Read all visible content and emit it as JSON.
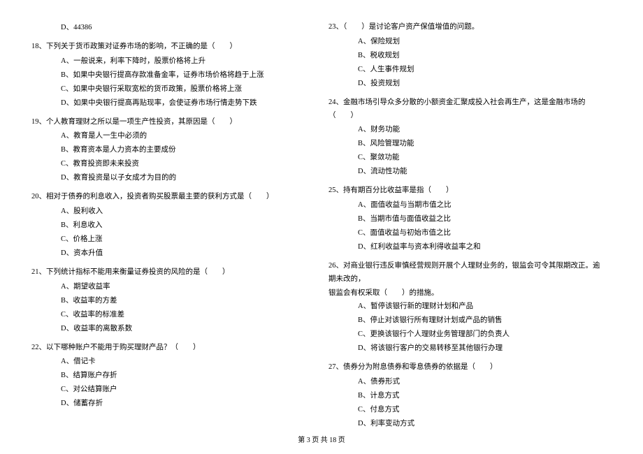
{
  "left": {
    "pre_option": "D、44386",
    "q18": {
      "stem": "18、下列关于货币政策对证券市场的影响，不正确的是（　　）",
      "A": "A、一般说来，利率下降时，股票价格将上升",
      "B": "B、如果中央银行提高存款准备金率，证券市场价格将趋于上涨",
      "C": "C、如果中央银行采取宽松的货币政策，股票价格将上涨",
      "D": "D、如果中央银行提高再贴现率，会使证券市场行情走势下跌"
    },
    "q19": {
      "stem": "19、个人教育理财之所以是一项生产性投资，其原因是（　　）",
      "A": "A、教育是人一生中必须的",
      "B": "B、教育资本是人力资本的主要成份",
      "C": "C、教育投资即未来投资",
      "D": "D、教育投资是以子女成才为目的的"
    },
    "q20": {
      "stem": "20、相对于债券的利息收入，投资者购买股票最主要的获利方式是（　　）",
      "A": "A、股利收入",
      "B": "B、利息收入",
      "C": "C、价格上涨",
      "D": "D、资本升值"
    },
    "q21": {
      "stem": "21、下列统计指标不能用来衡量证券投资的风险的是（　　）",
      "A": "A、期望收益率",
      "B": "B、收益率的方差",
      "C": "C、收益率的标准差",
      "D": "D、收益率的离散系数"
    },
    "q22": {
      "stem": "22、以下哪种账户不能用于购买理财产品？（　　）",
      "A": "A、借记卡",
      "B": "B、结算账户存折",
      "C": "C、对公结算账户",
      "D": "D、储蓄存折"
    }
  },
  "right": {
    "q23": {
      "stem": "23、（　　）是讨论客户资产保值增值的问题。",
      "A": "A、保险规划",
      "B": "B、税收规划",
      "C": "C、人生事件规划",
      "D": "D、投资规划"
    },
    "q24": {
      "stem": "24、金融市场引导众多分散的小额资金汇聚成投入社会再生产，这是金融市场的（　　）",
      "A": "A、财务功能",
      "B": "B、风险管理功能",
      "C": "C、聚敛功能",
      "D": "D、流动性功能"
    },
    "q25": {
      "stem": "25、持有期百分比收益率是指（　　）",
      "A": "A、面值收益与当期市值之比",
      "B": "B、当期市值与面值收益之比",
      "C": "C、面值收益与初始市值之比",
      "D": "D、红利收益率与资本利得收益率之和"
    },
    "q26": {
      "stem_line1": "26、对商业银行违反审慎经营规则开展个人理财业务的，银监会可令其限期改正。逾期未改的，",
      "stem_line2": "银监会有权采取（　　）的措施。",
      "A": "A、暂停该银行新的理财计划和产品",
      "B": "B、停止对该银行所有理财计划或产品的销售",
      "C": "C、更换该银行个人理财业务管理部门的负责人",
      "D": "D、将该银行客户的交易转移至其他银行办理"
    },
    "q27": {
      "stem": "27、债券分为附息债券和零息债券的依据是（　　）",
      "A": "A、债券形式",
      "B": "B、计息方式",
      "C": "C、付息方式",
      "D": "D、利率变动方式"
    }
  },
  "footer": "第 3 页 共 18 页"
}
